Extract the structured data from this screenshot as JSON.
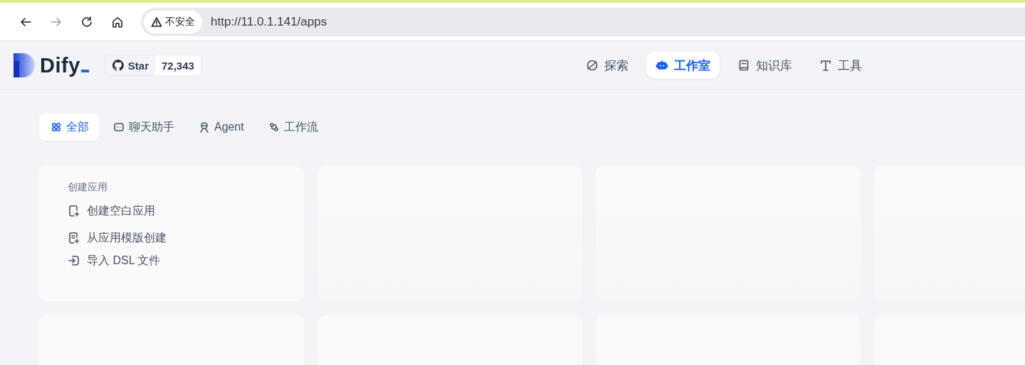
{
  "browser": {
    "security_label": "不安全",
    "url": "http://11.0.1.141/apps"
  },
  "header": {
    "logo_text": "Dify",
    "star_label": "Star",
    "star_count": "72,343",
    "nav": [
      {
        "kind": "explore",
        "label": "探索",
        "selected": false
      },
      {
        "kind": "studio",
        "label": "工作室",
        "selected": true
      },
      {
        "kind": "knowledge",
        "label": "知识库",
        "selected": false
      },
      {
        "kind": "tools",
        "label": "工具",
        "selected": false
      }
    ]
  },
  "filters": [
    {
      "kind": "all",
      "label": "全部",
      "selected": true
    },
    {
      "kind": "chat",
      "label": "聊天助手",
      "selected": false
    },
    {
      "kind": "agent",
      "label": "Agent",
      "selected": false
    },
    {
      "kind": "workflow",
      "label": "工作流",
      "selected": false
    }
  ],
  "create_card": {
    "title": "创建应用",
    "actions": [
      {
        "kind": "blank",
        "label": "创建空白应用"
      },
      {
        "kind": "template",
        "label": "从应用模版创建"
      },
      {
        "kind": "import",
        "label": "导入 DSL 文件"
      }
    ]
  },
  "app_cards": [
    {
      "kind": "placeholder"
    },
    {
      "kind": "placeholder"
    },
    {
      "kind": "placeholder"
    },
    {
      "kind": "placeholder"
    },
    {
      "kind": "placeholder"
    },
    {
      "kind": "placeholder"
    },
    {
      "kind": "placeholder"
    }
  ]
}
